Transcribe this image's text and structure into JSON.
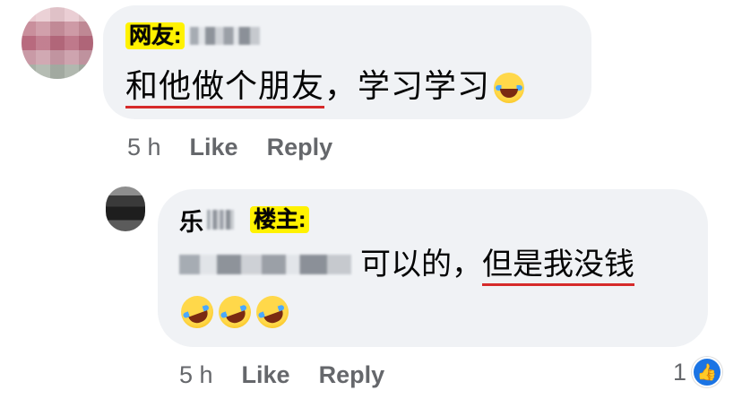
{
  "comment1": {
    "tag": "网友:",
    "message_underlined": "和他做个朋友",
    "message_rest": "，学习学习",
    "emoji": "laughing-tears-emoji",
    "time": "5 h",
    "like_label": "Like",
    "reply_label": "Reply"
  },
  "comment2": {
    "name_char": "乐",
    "tag": "楼主:",
    "message_plain": "可以的，",
    "message_underlined": "但是我没钱",
    "emojis": [
      "rofl-emoji",
      "rofl-emoji",
      "rofl-emoji"
    ],
    "time": "5 h",
    "like_label": "Like",
    "reply_label": "Reply",
    "reaction_count": "1",
    "reaction_icon": "thumbs-up-icon"
  },
  "colors": {
    "bubble": "#f0f2f5",
    "meta_text": "#65676b",
    "highlight_tag": "#fff200",
    "underline": "#d62a2a",
    "like_blue": "#1b74e4"
  }
}
